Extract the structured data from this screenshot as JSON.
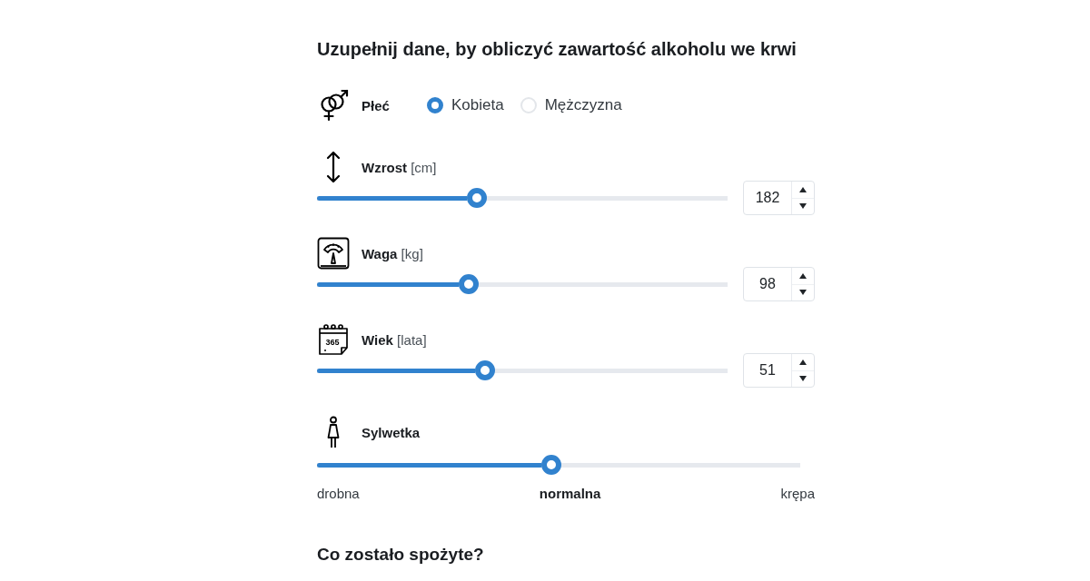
{
  "title": "Uzupełnij dane, by obliczyć zawartość alkoholu we krwi",
  "gender": {
    "label": "Płeć",
    "options": [
      {
        "label": "Kobieta",
        "selected": true
      },
      {
        "label": "Mężczyzna",
        "selected": false
      }
    ]
  },
  "measures": [
    {
      "kind": "height",
      "label": "**Wzrost** [cm]",
      "level": 0.39,
      "value": "182"
    },
    {
      "kind": "weight",
      "label": "**Waga** [kg]",
      "level": 0.37,
      "value": "98"
    },
    {
      "kind": "age",
      "label": "**Wiek** [lata]",
      "icon_text": "365",
      "level": 0.41,
      "value": "51"
    }
  ],
  "build": {
    "label": "Sylwetka",
    "level": 0.485,
    "options": [
      {
        "label": "drobna",
        "selected": false
      },
      {
        "label": "normalna",
        "selected": true
      },
      {
        "label": "krępa",
        "selected": false
      }
    ]
  },
  "next_heading": "Co zostało spożyte?"
}
